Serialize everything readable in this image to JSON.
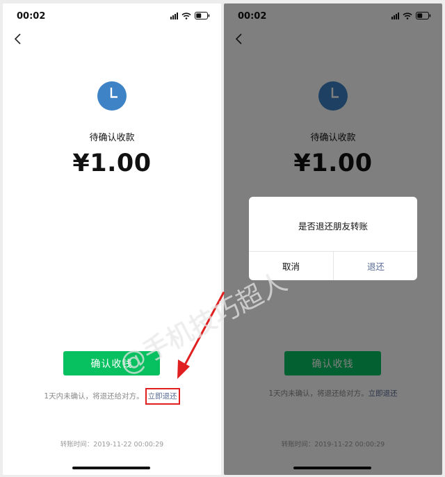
{
  "left_screen": {
    "status_bar": {
      "time": "00:02"
    },
    "status_title": "待确认收款",
    "amount": "¥1.00",
    "confirm_button": "确认收钱",
    "notice_text": "1天内未确认，将退还给对方。",
    "refund_link": "立即退还",
    "transfer_time": "转账时间：2019-11-22 00:00:29"
  },
  "right_screen": {
    "status_bar": {
      "time": "00:02"
    },
    "status_title": "待确认收款",
    "amount": "¥1.00",
    "confirm_button": "确认收钱",
    "notice_text": "1天内未确认，将退还给对方。",
    "refund_link": "立即退还",
    "transfer_time": "转账时间：2019-11-22 00:00:29",
    "dialog": {
      "message": "是否退还朋友转账",
      "cancel_label": "取消",
      "refund_label": "退还"
    }
  },
  "watermark": "@手机技巧超人",
  "icons": {
    "back": "chevron-left-icon",
    "clock": "clock-icon",
    "signal": "signal-icon",
    "wifi": "wifi-icon",
    "battery": "battery-icon"
  },
  "colors": {
    "wechat_green": "#07c160",
    "link_blue": "#576b95",
    "clock_blue": "#3d83c6",
    "annotation_red": "#e02020"
  }
}
